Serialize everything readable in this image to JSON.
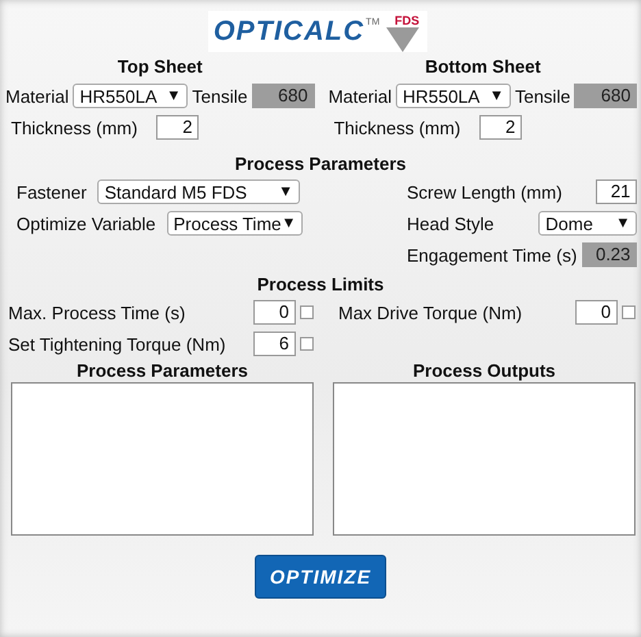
{
  "logo": {
    "name": "OPTICALC",
    "trademark": "TM",
    "badge": "FDS"
  },
  "sheets": [
    {
      "title": "Top Sheet",
      "material": {
        "label": "Material",
        "value": "HR550LA",
        "arrow": "▼"
      },
      "tensile": {
        "label": "Tensile",
        "value": "680",
        "readonly": true
      },
      "thickness": {
        "label": "Thickness (mm)",
        "value": "2",
        "readonly": false
      }
    },
    {
      "title": "Bottom Sheet",
      "material": {
        "label": "Material",
        "value": "HR550LA",
        "arrow": "▼"
      },
      "tensile": {
        "label": "Tensile",
        "value": "680",
        "readonly": true
      },
      "thickness": {
        "label": "Thickness (mm)",
        "value": "2",
        "readonly": false
      }
    }
  ],
  "process_parameters": {
    "title": "Process Parameters",
    "left": [
      {
        "kind": "select",
        "label": "Fastener",
        "value": "Standard M5 FDS",
        "arrow": "▼"
      },
      {
        "kind": "select",
        "label": "Optimize Variable",
        "value": "Process Time",
        "arrow": "▼"
      }
    ],
    "right": [
      {
        "kind": "input",
        "label": "Screw Length (mm)",
        "value": "21",
        "readonly": false
      },
      {
        "kind": "select",
        "label": "Head Style",
        "value": "Dome",
        "arrow": "▼"
      },
      {
        "kind": "input",
        "label": "Engagement Time (s)",
        "value": "0.23",
        "readonly": true
      }
    ]
  },
  "process_limits": {
    "title": "Process Limits",
    "left": [
      {
        "label": "Max. Process Time (s)",
        "value": "0",
        "checked": false
      },
      {
        "label": "Set Tightening Torque (Nm)",
        "value": "6",
        "checked": false
      }
    ],
    "right": [
      {
        "label": "Max Drive Torque (Nm)",
        "value": "0",
        "checked": false
      }
    ]
  },
  "panels": [
    {
      "title": "Process Parameters"
    },
    {
      "title": "Process Outputs"
    }
  ],
  "button": "OPTIMIZE"
}
